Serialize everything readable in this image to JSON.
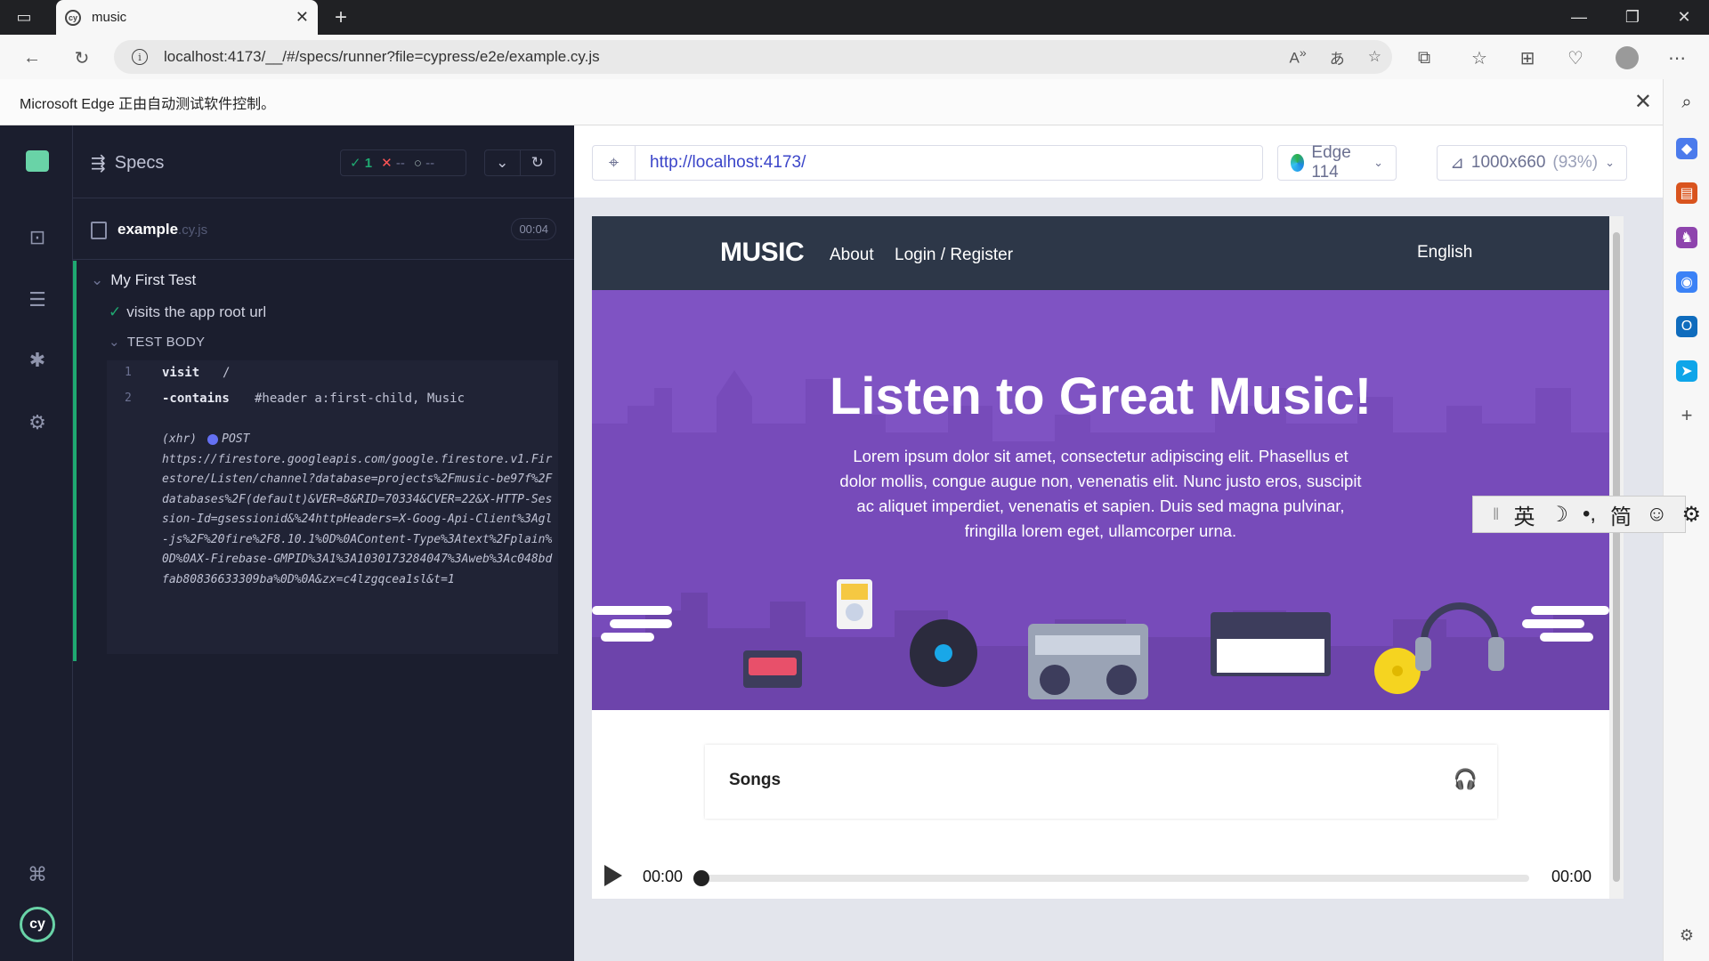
{
  "browser": {
    "tab_title": "music",
    "tab_favicon": "cy",
    "address": "localhost:4173/__/#/specs/runner?file=cypress/e2e/example.cy.js",
    "info_bar": "Microsoft Edge 正由自动测试软件控制。"
  },
  "reporter": {
    "specs_label": "Specs",
    "passed": "1",
    "failed": "--",
    "pending": "--",
    "spec_name": "example",
    "spec_ext": ".cy.js",
    "duration": "00:04",
    "suite_title": "My First Test",
    "test_title": "visits the app root url",
    "body_title": "TEST BODY",
    "commands": [
      {
        "num": "1",
        "name": "visit",
        "msg": "/"
      },
      {
        "num": "2",
        "name": "-contains",
        "msg": "#header a:first-child, Music"
      }
    ],
    "xhr_label": "(xhr)",
    "xhr_method": "POST",
    "xhr_url": "https://firestore.googleapis.com/google.firestore.v1.Firestore/Listen/channel?database=projects%2Fmusic-be97f%2Fdatabases%2F(default)&VER=8&RID=70334&CVER=22&X-HTTP-Session-Id=gsessionid&%24httpHeaders=X-Goog-Api-Client%3Agl-js%2F%20fire%2F8.10.1%0D%0AContent-Type%3Atext%2Fplain%0D%0AX-Firebase-GMPID%3A1%3A1030173284047%3Aweb%3Ac048bdfab80836633309ba%0D%0A&zx=c4lzgqcea1sl&t=1"
  },
  "aut": {
    "url": "http://localhost:4173/",
    "browser": "Edge 114",
    "viewport": "1000x660",
    "viewport_scale": "(93%)"
  },
  "app": {
    "brand": "MUSIC",
    "nav_about": "About",
    "nav_login": "Login / Register",
    "nav_lang": "English",
    "hero_title": "Listen to Great Music!",
    "hero_text": "Lorem ipsum dolor sit amet, consectetur adipiscing elit. Phasellus et dolor mollis, congue augue non, venenatis elit. Nunc justo eros, suscipit ac aliquet imperdiet, venenatis et sapien. Duis sed magna pulvinar, fringilla lorem eget, ullamcorper urna.",
    "songs_title": "Songs",
    "time_current": "00:00",
    "time_total": "00:00",
    "player_progress": 0
  },
  "ime": {
    "mode": "英",
    "moon": "☽",
    "punct": "•,",
    "script": "简",
    "smile": "☺",
    "gear": "⚙"
  },
  "colors": {
    "cypress_bg": "#1b1e2e",
    "pass_green": "#1fa971",
    "hero_purple": "#7f53c3",
    "app_header": "#2d3748"
  }
}
